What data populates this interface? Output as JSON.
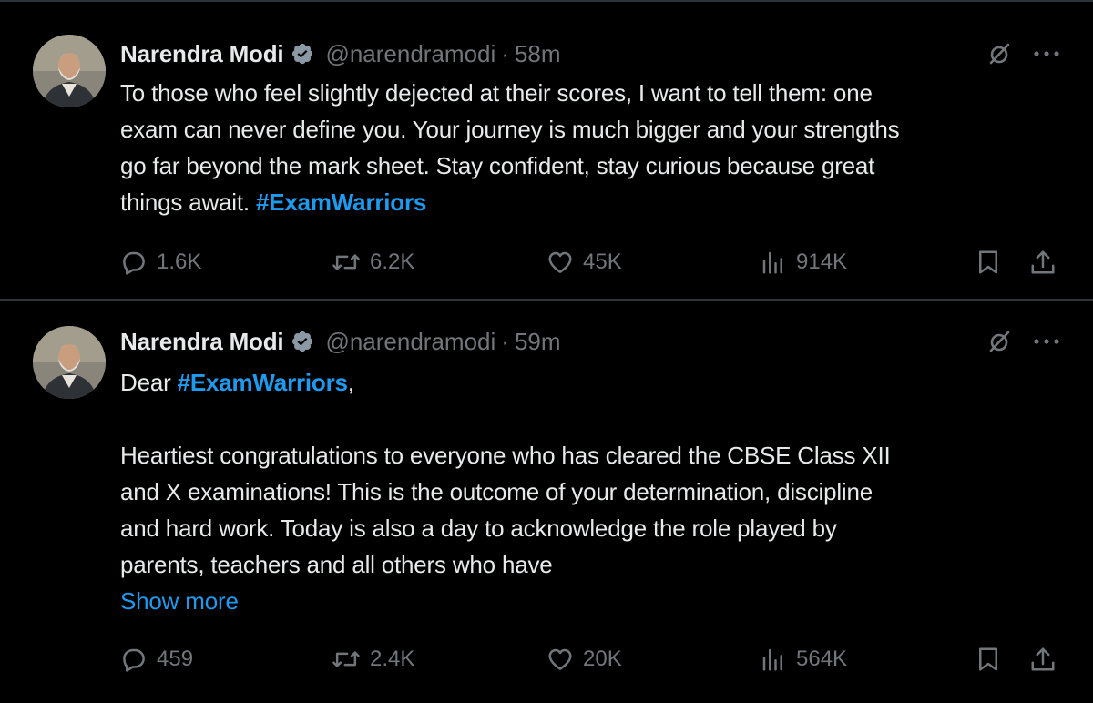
{
  "tweets": [
    {
      "author": {
        "name": "Narendra Modi",
        "handle": "@narendramodi"
      },
      "separator": "·",
      "time": "58m",
      "text": {
        "lines": [
          "To those who feel slightly dejected at their scores, I want to tell them: one",
          "exam can never define you. Your journey is much bigger and your strengths",
          "go far beyond the mark sheet. Stay confident, stay curious because great"
        ],
        "last_line_prefix": "things await.",
        "hashtag": "#ExamWarriors"
      },
      "stats": {
        "replies": "1.6K",
        "retweets": "6.2K",
        "likes": "45K",
        "views": "914K"
      }
    },
    {
      "author": {
        "name": "Narendra Modi",
        "handle": "@narendramodi"
      },
      "separator": "·",
      "time": "59m",
      "text": {
        "greeting_prefix": "Dear",
        "hashtag": "#ExamWarriors",
        "greeting_suffix": ",",
        "lines": [
          "Heartiest congratulations to everyone who has cleared the CBSE Class XII",
          "and X examinations! This is the outcome of your determination, discipline",
          "and hard work. Today is also a day to acknowledge the role played by",
          "parents, teachers and all others who have"
        ],
        "show_more": "Show more"
      },
      "stats": {
        "replies": "459",
        "retweets": "2.4K",
        "likes": "20K",
        "views": "564K"
      }
    }
  ],
  "icons": {
    "verified": "verified-badge-icon",
    "grok": "grok-icon",
    "more": "more-options-icon",
    "reply": "reply-icon",
    "retweet": "retweet-icon",
    "like": "heart-icon",
    "views": "views-chart-icon",
    "bookmark": "bookmark-icon",
    "share": "share-icon"
  },
  "colors": {
    "background": "#000000",
    "text": "#e7e9ea",
    "secondary": "#71767b",
    "accent": "#1d9bf0",
    "divider": "#2f3336"
  }
}
